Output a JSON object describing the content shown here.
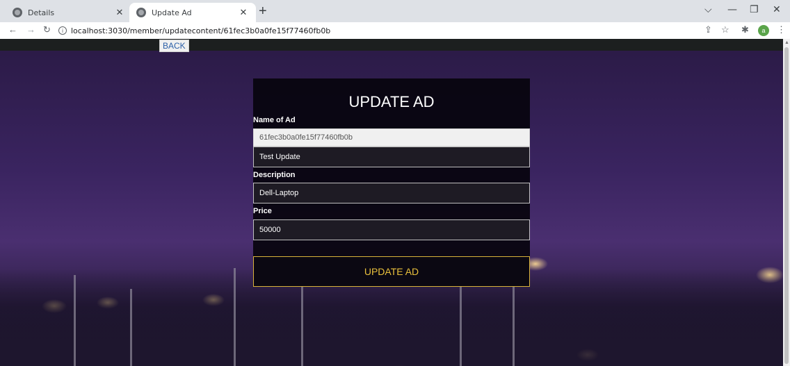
{
  "browser": {
    "tabs": [
      {
        "title": "Details",
        "active": false
      },
      {
        "title": "Update Ad",
        "active": true
      }
    ],
    "new_tab_glyph": "+",
    "url_host": "localhost",
    "url_rest": ":3030/member/updatecontent/61fec3b0a0fe15f77460fb0b",
    "profile_initial": "a",
    "icons": [
      "back-arrow-icon",
      "forward-arrow-icon",
      "reload-icon",
      "info-icon",
      "share-icon",
      "star-icon",
      "extensions-icon",
      "menu-dots-icon"
    ]
  },
  "page": {
    "back_label": "BACK",
    "form_title": "UPDATE AD",
    "fields": {
      "name_label": "Name of Ad",
      "id_value": "61fec3b0a0fe15f77460fb0b",
      "name_value": "Test Update",
      "description_label": "Description",
      "description_value": "Dell-Laptop",
      "price_label": "Price",
      "price_value": "50000"
    },
    "submit_label": "UPDATE AD",
    "colors": {
      "accent": "#e9c03c",
      "card_bg": "#08040e",
      "topbar": "#1c1f1f"
    }
  }
}
